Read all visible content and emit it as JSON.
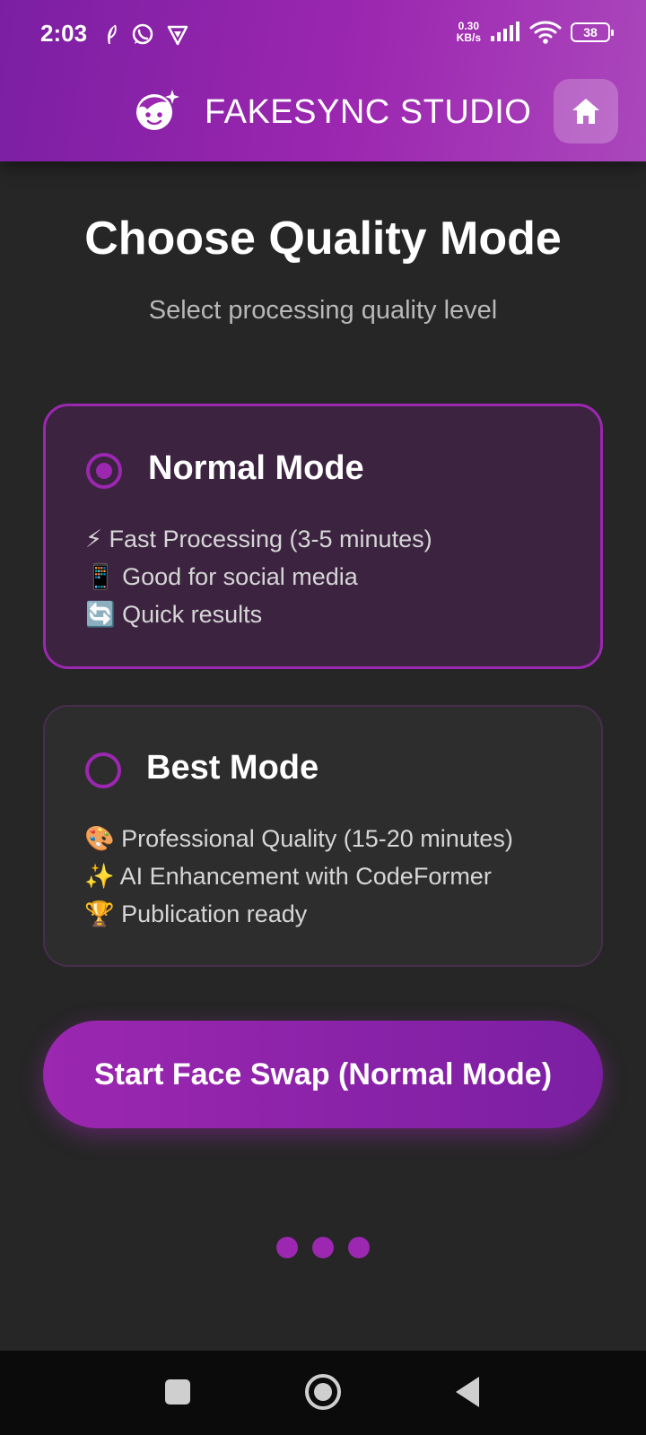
{
  "status_bar": {
    "time": "2:03",
    "net_speed_value": "0.30",
    "net_speed_unit": "KB/s",
    "battery": "38",
    "left_icons": [
      "feather-icon",
      "whatsapp-icon",
      "vpn-icon"
    ],
    "right_icons": [
      "signal-icon",
      "wifi-icon",
      "battery-icon"
    ]
  },
  "header": {
    "app_title": "FAKESYNC STUDIO",
    "logo_icon": "face-sparkle-icon",
    "home_icon": "home-icon"
  },
  "main": {
    "title": "Choose Quality Mode",
    "subtitle": "Select processing quality level"
  },
  "modes": [
    {
      "name": "Normal Mode",
      "selected": true,
      "features": [
        "⚡ Fast Processing (3-5 minutes)",
        "📱 Good for social media",
        "🔄 Quick results"
      ]
    },
    {
      "name": "Best Mode",
      "selected": false,
      "features": [
        "🎨 Professional Quality (15-20 minutes)",
        "✨ AI Enhancement with CodeFormer",
        "🏆 Publication ready"
      ]
    }
  ],
  "actions": {
    "start_label": "Start Face Swap (Normal Mode)"
  },
  "pagination": {
    "dots": 3
  },
  "colors": {
    "accent": "#9c27b0",
    "accent_dark": "#7b1fa2",
    "background": "#262626",
    "selected_card": "#3c2340"
  }
}
